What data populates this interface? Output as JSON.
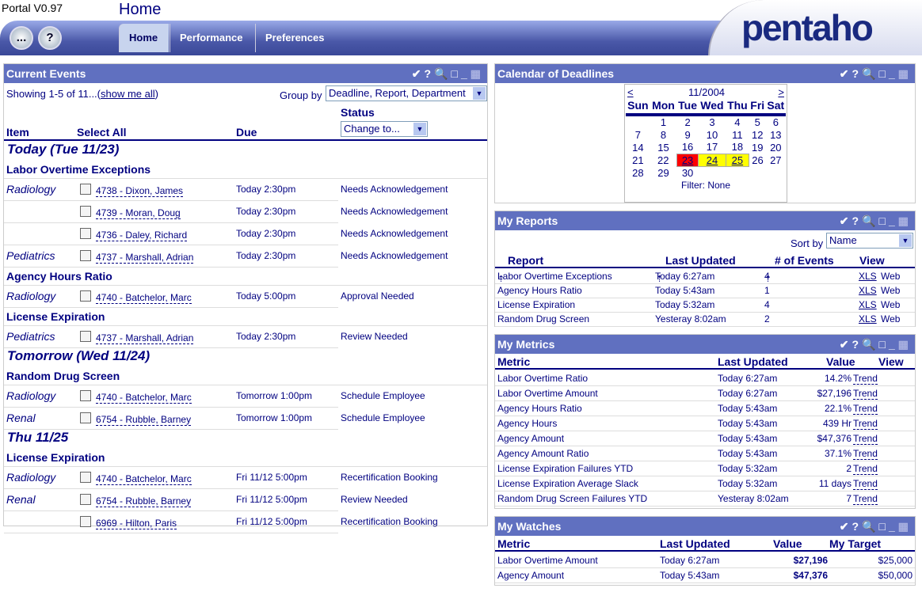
{
  "app": {
    "version": "Portal V0.97",
    "page_title": "Home",
    "logo": "pentaho",
    "menu_btn": "...",
    "help_btn": "?"
  },
  "tabs": [
    {
      "label": "Home"
    },
    {
      "label": "Performance"
    },
    {
      "label": "Preferences"
    }
  ],
  "panel_icons": {
    "check": "✔",
    "help": "?",
    "zoom": "🔍",
    "max": "□",
    "min": "_",
    "grid": "▦"
  },
  "events": {
    "title": "Current Events",
    "showing": "Showing 1-5 of 11...(",
    "show_all": "show me all",
    ")": ")",
    "group_by_label": "Group by",
    "group_by": "Deadline, Report, Department",
    "cols": {
      "item": "Item",
      "select_all": "Select All",
      "due": "Due",
      "status": "Status"
    },
    "change_to": "Change to...",
    "rows": [
      {
        "t": "day",
        "text": "Today (Tue 11/23)"
      },
      {
        "t": "grp",
        "text": "Labor Overtime Exceptions"
      },
      {
        "t": "item",
        "dept": "Radiology",
        "name": "4738 - Dixon, James",
        "due": "Today 2:30pm",
        "status": "Needs Acknowledgement"
      },
      {
        "t": "item",
        "dept": "",
        "name": "4739 - Moran, Doug",
        "due": "Today 2:30pm",
        "status": "Needs Acknowledgement"
      },
      {
        "t": "item",
        "dept": "",
        "name": "4736 - Daley, Richard",
        "due": "Today 2:30pm",
        "status": "Needs Acknowledgement"
      },
      {
        "t": "item",
        "dept": "Pediatrics",
        "name": "4737 - Marshall, Adrian",
        "due": "Today 2:30pm",
        "status": "Needs Acknowledgement"
      },
      {
        "t": "grp",
        "text": "Agency Hours Ratio"
      },
      {
        "t": "item",
        "dept": "Radiology",
        "name": "4740 - Batchelor, Marc",
        "due": "Today 5:00pm",
        "status": "Approval Needed"
      },
      {
        "t": "grp",
        "text": "License Expiration"
      },
      {
        "t": "item",
        "dept": "Pediatrics",
        "name": "4737 - Marshall, Adrian",
        "due": "Today 2:30pm",
        "status": "Review Needed"
      },
      {
        "t": "day",
        "text": "Tomorrow (Wed 11/24)"
      },
      {
        "t": "grp",
        "text": "Random Drug Screen"
      },
      {
        "t": "item",
        "dept": "Radiology",
        "name": "4740 - Batchelor, Marc",
        "due": "Tomorrow 1:00pm",
        "status": "Schedule Employee"
      },
      {
        "t": "item",
        "dept": "Renal",
        "name": "6754 - Rubble, Barney",
        "due": "Tomorrow 1:00pm",
        "status": "Schedule Employee"
      },
      {
        "t": "day",
        "text": "Thu 11/25"
      },
      {
        "t": "grp",
        "text": "License Expiration"
      },
      {
        "t": "item",
        "dept": "Radiology",
        "name": "4740 - Batchelor, Marc",
        "due": "Fri 11/12 5:00pm",
        "status": "Recertification Booking"
      },
      {
        "t": "item",
        "dept": "Renal",
        "name": "6754 - Rubble, Barney",
        "due": "Fri 11/12 5:00pm",
        "status": "Review Needed"
      },
      {
        "t": "item",
        "dept": "",
        "name": "6969 - Hilton, Paris",
        "due": "Fri 11/12 5:00pm",
        "status": "Recertification Booking"
      }
    ]
  },
  "calendar": {
    "title": "Calendar of Deadlines",
    "prev": "<",
    "next": ">",
    "month": "11/2004",
    "days": [
      "Sun",
      "Mon",
      "Tue",
      "Wed",
      "Thu",
      "Fri",
      "Sat"
    ],
    "weeks": [
      [
        "",
        "1",
        "2",
        "3",
        "4",
        "5",
        "6"
      ],
      [
        "7",
        "8",
        "9",
        "10",
        "11",
        "12",
        "13"
      ],
      [
        "14",
        "15",
        "16",
        "17",
        "18",
        "19",
        "20"
      ],
      [
        "21",
        "22",
        "23",
        "24",
        "25",
        "26",
        "27"
      ],
      [
        "28",
        "29",
        "30",
        "",
        "",
        "",
        ""
      ]
    ],
    "highlights": {
      "23": "#ff0000",
      "24": "#ffff00",
      "25": "#ffff00"
    },
    "filter": "Filter: None"
  },
  "reports": {
    "title": "My Reports",
    "sort_label": "Sort by",
    "sort": "Name",
    "cols": [
      "Report",
      "Last Updated",
      "# of Events",
      "View"
    ],
    "rows": [
      [
        "Labor Overtime Exceptions",
        "Today 6:27am",
        "4"
      ],
      [
        "Agency Hours Ratio",
        "Today 5:43am",
        "1"
      ],
      [
        "License Expiration",
        "Today 5:32am",
        "4"
      ],
      [
        "Random Drug Screen",
        "Yesteray 8:02am",
        "2"
      ]
    ],
    "xls": "XLS",
    "web": "Web"
  },
  "metrics": {
    "title": "My Metrics",
    "cols": [
      "Metric",
      "Last Updated",
      "Value",
      "View"
    ],
    "trend": "Trend",
    "rows": [
      [
        "Labor Overtime Ratio",
        "Today 6:27am",
        "14.2%"
      ],
      [
        "Labor Overtime Amount",
        "Today 6:27am",
        "$27,196"
      ],
      [
        "Agency Hours Ratio",
        "Today 5:43am",
        "22.1%"
      ],
      [
        "Agency Hours",
        "Today 5:43am",
        "439 Hr"
      ],
      [
        "Agency Amount",
        "Today 5:43am",
        "$47,376"
      ],
      [
        "Agency Amount Ratio",
        "Today 5:43am",
        "37.1%"
      ],
      [
        "License Expiration Failures YTD",
        "Today 5:32am",
        "2"
      ],
      [
        "License Expiration Average Slack",
        "Today 5:32am",
        "11 days"
      ],
      [
        "Random Drug Screen Failures YTD",
        "Yesteray 8:02am",
        "7"
      ]
    ]
  },
  "watches": {
    "title": "My Watches",
    "cols": [
      "Metric",
      "Last Updated",
      "Value",
      "My Target"
    ],
    "rows": [
      [
        "Labor Overtime Amount",
        "Today 6:27am",
        "$27,196",
        "$25,000"
      ],
      [
        "Agency Amount",
        "Today 5:43am",
        "$47,376",
        "$50,000"
      ]
    ]
  }
}
